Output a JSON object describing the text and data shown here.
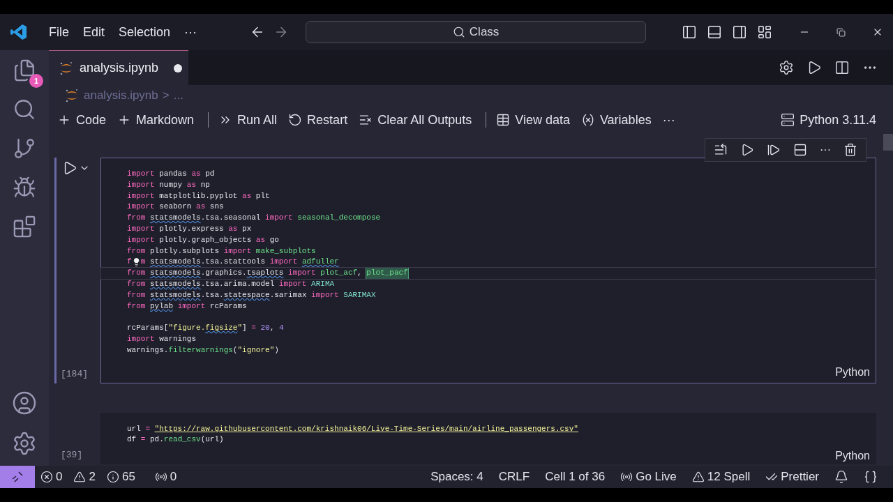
{
  "menu": [
    "File",
    "Edit",
    "Selection",
    "···"
  ],
  "search": {
    "value": "Class"
  },
  "tab": {
    "title": "analysis.ipynb",
    "modified": true,
    "selected": true
  },
  "breadcrumb": [
    "analysis.ipynb",
    ">",
    "..."
  ],
  "explorer_badge": "1",
  "toolbar": [
    {
      "label": "Code",
      "kind": "plus"
    },
    {
      "label": "Markdown",
      "kind": "plus"
    },
    {
      "kind": "sep"
    },
    {
      "label": "Run All",
      "kind": "runall"
    },
    {
      "label": "Restart",
      "kind": "restart"
    },
    {
      "label": "Clear All Outputs",
      "kind": "clear"
    },
    {
      "kind": "sep"
    },
    {
      "label": "View data",
      "kind": "viewdata"
    },
    {
      "label": "Variables",
      "kind": "variables"
    },
    {
      "label": "···",
      "kind": "more"
    }
  ],
  "kernel": "Python 3.11.4",
  "cell_toolbar_more": "···",
  "cells": [
    {
      "selected": true,
      "count": "[184]",
      "language": "Python",
      "lines": [
        {
          "tokens": [
            {
              "text": "import ",
              "kind": "kw"
            },
            {
              "text": "pandas ",
              "kind": "id"
            },
            {
              "text": "as ",
              "kind": "kw"
            },
            {
              "text": "pd",
              "kind": "id"
            }
          ]
        },
        {
          "tokens": [
            {
              "text": "import ",
              "kind": "kw"
            },
            {
              "text": "numpy ",
              "kind": "id"
            },
            {
              "text": "as ",
              "kind": "kw"
            },
            {
              "text": "np",
              "kind": "id"
            }
          ]
        },
        {
          "tokens": [
            {
              "text": "import ",
              "kind": "kw"
            },
            {
              "text": "matplotlib.pyplot ",
              "kind": "id"
            },
            {
              "text": "as ",
              "kind": "kw"
            },
            {
              "text": "plt",
              "kind": "id"
            }
          ]
        },
        {
          "tokens": [
            {
              "text": "import ",
              "kind": "kw"
            },
            {
              "text": "seaborn ",
              "kind": "id"
            },
            {
              "text": "as ",
              "kind": "kw"
            },
            {
              "text": "sns",
              "kind": "id"
            }
          ]
        },
        {
          "tokens": [
            {
              "text": "from ",
              "kind": "kw"
            },
            {
              "text": "statsmodels",
              "kind": "id",
              "squiggle": true
            },
            {
              "text": ".tsa.seasonal ",
              "kind": "id"
            },
            {
              "text": "import ",
              "kind": "kw"
            },
            {
              "text": "seasonal_decompose",
              "kind": "fn"
            }
          ]
        },
        {
          "tokens": [
            {
              "text": "import ",
              "kind": "kw"
            },
            {
              "text": "plotly.express ",
              "kind": "id"
            },
            {
              "text": "as ",
              "kind": "kw"
            },
            {
              "text": "px",
              "kind": "id"
            }
          ]
        },
        {
          "tokens": [
            {
              "text": "import ",
              "kind": "kw"
            },
            {
              "text": "plotly.graph_objects ",
              "kind": "id"
            },
            {
              "text": "as ",
              "kind": "kw"
            },
            {
              "text": "go",
              "kind": "id"
            }
          ]
        },
        {
          "tokens": [
            {
              "text": "from ",
              "kind": "kw"
            },
            {
              "text": "plotly.subplots ",
              "kind": "id"
            },
            {
              "text": "import ",
              "kind": "kw"
            },
            {
              "text": "make_subplots",
              "kind": "fn"
            }
          ]
        },
        {
          "bulb": true,
          "tokens": [
            {
              "text": "f",
              "kind": "kw"
            },
            {
              "text": "m ",
              "kind": "kw"
            },
            {
              "text": "statsmodels",
              "kind": "id",
              "squiggle": true
            },
            {
              "text": ".tsa.stattools ",
              "kind": "id"
            },
            {
              "text": "import ",
              "kind": "kw"
            },
            {
              "text": "adfuller",
              "kind": "fn",
              "squiggle": true
            }
          ]
        },
        {
          "current": true,
          "tokens": [
            {
              "text": "from ",
              "kind": "kw"
            },
            {
              "text": "statsmodels",
              "kind": "id",
              "squiggle": true
            },
            {
              "text": ".graphics.",
              "kind": "id"
            },
            {
              "text": "tsaplots",
              "kind": "id",
              "squiggle": true
            },
            {
              "text": " import ",
              "kind": "kw"
            },
            {
              "text": "plot_acf",
              "kind": "fn"
            },
            {
              "text": ", ",
              "kind": "id"
            },
            {
              "text": "plot_pacf",
              "kind": "fn",
              "highlight": true
            }
          ]
        },
        {
          "tokens": [
            {
              "text": "from ",
              "kind": "kw"
            },
            {
              "text": "statsmodels",
              "kind": "id",
              "squiggle": true
            },
            {
              "text": ".tsa.arima.model ",
              "kind": "id"
            },
            {
              "text": "import ",
              "kind": "kw"
            },
            {
              "text": "ARIMA",
              "kind": "cls"
            }
          ]
        },
        {
          "tokens": [
            {
              "text": "from ",
              "kind": "kw"
            },
            {
              "text": "statsmodels",
              "kind": "id",
              "squiggle": true
            },
            {
              "text": ".tsa.",
              "kind": "id"
            },
            {
              "text": "statespace",
              "kind": "id",
              "squiggle": true
            },
            {
              "text": ".sarimax ",
              "kind": "id"
            },
            {
              "text": "import ",
              "kind": "kw"
            },
            {
              "text": "SARIMAX",
              "kind": "cls"
            }
          ]
        },
        {
          "tokens": [
            {
              "text": "from ",
              "kind": "kw"
            },
            {
              "text": "pylab",
              "kind": "id",
              "squiggle": true
            },
            {
              "text": " import ",
              "kind": "kw"
            },
            {
              "text": "rcParams",
              "kind": "id"
            }
          ]
        },
        {
          "space_before": true,
          "tokens": [
            {
              "text": "rcParams[",
              "kind": "id"
            },
            {
              "text": "\"figure.",
              "kind": "str"
            },
            {
              "text": "figsize",
              "kind": "str",
              "squiggle": true
            },
            {
              "text": "\"",
              "kind": "str"
            },
            {
              "text": "] ",
              "kind": "id"
            },
            {
              "text": "= ",
              "kind": "op"
            },
            {
              "text": "20",
              "kind": "num"
            },
            {
              "text": ", ",
              "kind": "id"
            },
            {
              "text": "4",
              "kind": "num"
            }
          ]
        },
        {
          "tokens": [
            {
              "text": "import ",
              "kind": "kw"
            },
            {
              "text": "warnings",
              "kind": "id"
            }
          ]
        },
        {
          "tokens": [
            {
              "text": "warnings.",
              "kind": "id"
            },
            {
              "text": "filterwarnings",
              "kind": "fn"
            },
            {
              "text": "(",
              "kind": "id"
            },
            {
              "text": "\"ignore\"",
              "kind": "str"
            },
            {
              "text": ")",
              "kind": "id"
            }
          ]
        }
      ]
    },
    {
      "selected": false,
      "count": "[39]",
      "language": "Python",
      "lines": [
        {
          "tokens": [
            {
              "text": "url ",
              "kind": "id"
            },
            {
              "text": "= ",
              "kind": "op"
            },
            {
              "text": "\"https://raw.githubusercontent.com/krishnaik06/Live-Time-Series/main/airline_passengers.csv\"",
              "kind": "link"
            }
          ]
        },
        {
          "tokens": [
            {
              "text": "df ",
              "kind": "id"
            },
            {
              "text": "= ",
              "kind": "op"
            },
            {
              "text": "pd.",
              "kind": "id"
            },
            {
              "text": "read_csv",
              "kind": "fn"
            },
            {
              "text": "(url)",
              "kind": "id"
            }
          ]
        }
      ]
    }
  ],
  "status_left": [
    {
      "kind": "error",
      "text": "0"
    },
    {
      "kind": "warning",
      "text": "2"
    },
    {
      "kind": "info",
      "text": "65"
    },
    {
      "kind": "ports",
      "text": "0"
    }
  ],
  "status_right": [
    {
      "kind": "plain",
      "text": "Spaces: 4"
    },
    {
      "kind": "plain",
      "text": "CRLF"
    },
    {
      "kind": "plain",
      "text": "Cell 1 of 36"
    },
    {
      "kind": "live",
      "text": "Go Live"
    },
    {
      "kind": "warning",
      "text": "12 Spell"
    },
    {
      "kind": "prettier",
      "text": "Prettier"
    },
    {
      "kind": "bell"
    },
    {
      "kind": "braces"
    }
  ]
}
